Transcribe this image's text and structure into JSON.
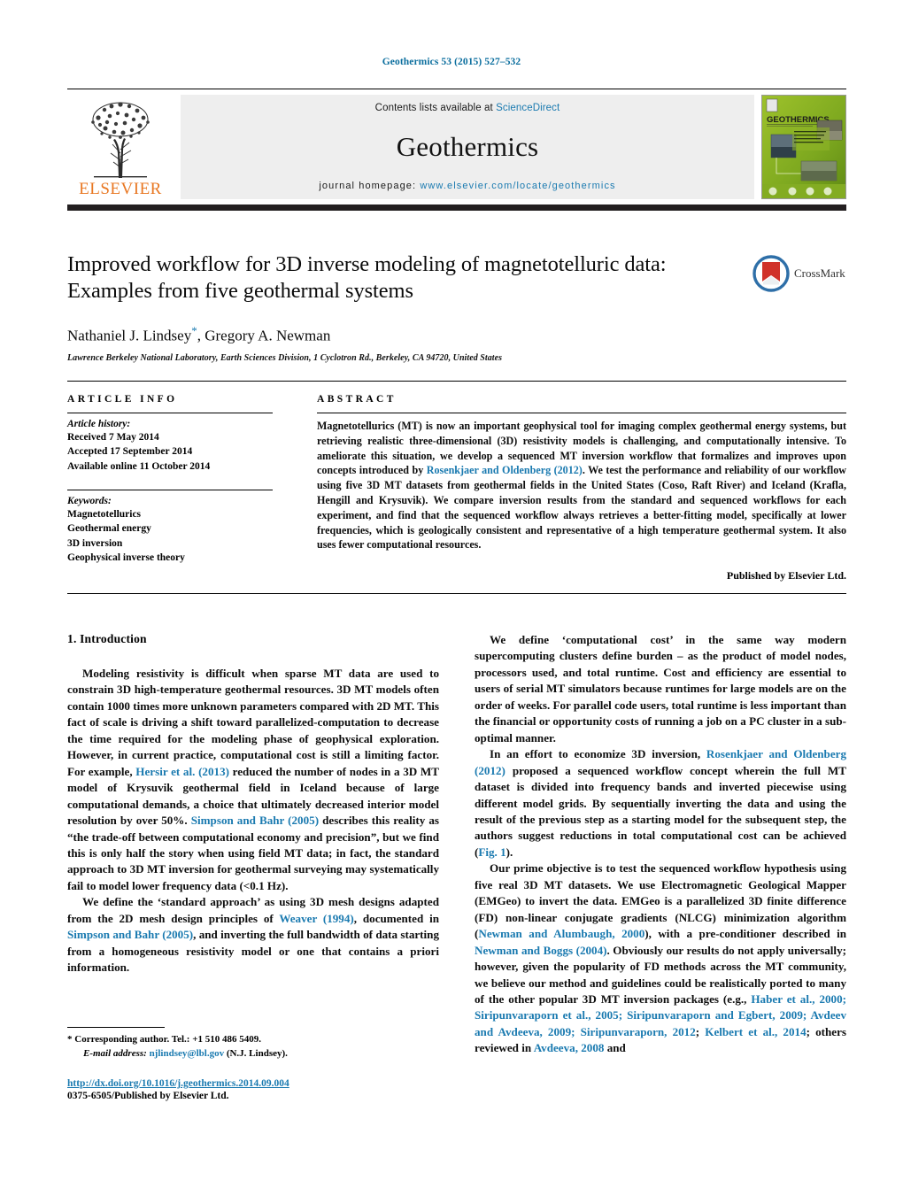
{
  "running_head": "Geothermics 53 (2015) 527–532",
  "masthead": {
    "contents_prefix": "Contents lists available at ",
    "contents_link": "ScienceDirect",
    "journal_title": "Geothermics",
    "homepage_prefix": "journal homepage: ",
    "homepage_url": "www.elsevier.com/locate/geothermics",
    "publisher_logo_text": "ELSEVIER",
    "cover_title": "GEOTHERMICS"
  },
  "title_block": {
    "title": "Improved workflow for 3D inverse modeling of magnetotelluric data: Examples from five geothermal systems",
    "crossmark_label": "CrossMark",
    "authors": "Nathaniel J. Lindsey",
    "authors_tail": ", Gregory A. Newman",
    "corresponding_marker": "*",
    "affiliation": "Lawrence Berkeley National Laboratory, Earth Sciences Division, 1 Cyclotron Rd., Berkeley, CA 94720, United States"
  },
  "article_info": {
    "heading": "ARTICLE INFO",
    "history_label": "Article history:",
    "history": [
      "Received 7 May 2014",
      "Accepted 17 September 2014",
      "Available online 11 October 2014"
    ],
    "keywords_label": "Keywords:",
    "keywords": [
      "Magnetotellurics",
      "Geothermal energy",
      "3D inversion",
      "Geophysical inverse theory"
    ]
  },
  "abstract": {
    "heading": "ABSTRACT",
    "part1": "Magnetotellurics (MT) is now an important geophysical tool for imaging complex geothermal energy systems, but retrieving realistic three-dimensional (3D) resistivity models is challenging, and computationally intensive. To ameliorate this situation, we develop a sequenced MT inversion workflow that formalizes and improves upon concepts introduced by ",
    "ref1": "Rosenkjaer and Oldenberg (2012)",
    "part2": ". We test the performance and reliability of our workflow using five 3D MT datasets from geothermal fields in the United States (Coso, Raft River) and Iceland (Krafla, Hengill and Krysuvik). We compare inversion results from the standard and sequenced workflows for each experiment, and find that the sequenced workflow always retrieves a better-fitting model, specifically at lower frequencies, which is geologically consistent and representative of a high temperature geothermal system. It also uses fewer computational resources.",
    "copyright": "Published by Elsevier Ltd."
  },
  "body": {
    "section_number_title": "1. Introduction",
    "left_paragraphs": [
      {
        "runs": [
          {
            "t": "Modeling resistivity is difficult when sparse MT data are used to constrain 3D high-temperature geothermal resources. 3D MT models often contain 1000 times more unknown parameters compared with 2D MT. This fact of scale is driving a shift toward parallelized-computation to decrease the time required for the modeling phase of geophysical exploration. However, in current practice, computational cost is still a limiting factor. For example, ",
            "ref": false
          },
          {
            "t": "Hersir et al. (2013)",
            "ref": true
          },
          {
            "t": " reduced the number of nodes in a 3D MT model of Krysuvik geothermal field in Iceland because of large computational demands, a choice that ultimately decreased interior model resolution by over 50%. ",
            "ref": false
          },
          {
            "t": "Simpson and Bahr (2005)",
            "ref": true
          },
          {
            "t": " describes this reality as “the trade-off between computational economy and precision”, but we find this is only half the story when using field MT data; in fact, the standard approach to 3D MT inversion for geothermal surveying may systematically fail to model lower frequency data (<0.1 Hz).",
            "ref": false
          }
        ]
      },
      {
        "runs": [
          {
            "t": "We define the ‘standard approach’ as using 3D mesh designs adapted from the 2D mesh design principles of ",
            "ref": false
          },
          {
            "t": "Weaver (1994)",
            "ref": true
          },
          {
            "t": ", documented in ",
            "ref": false
          },
          {
            "t": "Simpson and Bahr (2005)",
            "ref": true
          },
          {
            "t": ", and inverting the full bandwidth of data starting from a homogeneous resistivity model or one that contains a priori information.",
            "ref": false
          }
        ]
      }
    ],
    "right_paragraphs": [
      {
        "runs": [
          {
            "t": "We define ‘computational cost’ in the same way modern supercomputing clusters define burden – as the product of model nodes, processors used, and total runtime. Cost and efficiency are essential to users of serial MT simulators because runtimes for large models are on the order of weeks. For parallel code users, total runtime is less important than the financial or opportunity costs of running a job on a PC cluster in a sub-optimal manner.",
            "ref": false
          }
        ]
      },
      {
        "runs": [
          {
            "t": "In an effort to economize 3D inversion, ",
            "ref": false
          },
          {
            "t": "Rosenkjaer and Oldenberg (2012)",
            "ref": true
          },
          {
            "t": " proposed a sequenced workflow concept wherein the full MT dataset is divided into frequency bands and inverted piecewise using different model grids. By sequentially inverting the data and using the result of the previous step as a starting model for the subsequent step, the authors suggest reductions in total computational cost can be achieved (",
            "ref": false
          },
          {
            "t": "Fig. 1",
            "ref": true
          },
          {
            "t": ").",
            "ref": false
          }
        ]
      },
      {
        "runs": [
          {
            "t": "Our prime objective is to test the sequenced workflow hypothesis using five real 3D MT datasets. We use Electromagnetic Geological Mapper (EMGeo) to invert the data. EMGeo is a parallelized 3D finite difference (FD) non-linear conjugate gradients (NLCG) minimization algorithm (",
            "ref": false
          },
          {
            "t": "Newman and Alumbaugh, 2000",
            "ref": true
          },
          {
            "t": "), with a pre-conditioner described in ",
            "ref": false
          },
          {
            "t": "Newman and Boggs (2004)",
            "ref": true
          },
          {
            "t": ". Obviously our results do not apply universally; however, given the popularity of FD methods across the MT community, we believe our method and guidelines could be realistically ported to many of the other popular 3D MT inversion packages (e.g., ",
            "ref": false
          },
          {
            "t": "Haber et al., 2000; Siripunvaraporn et al., 2005; Siripunvaraporn and Egbert, 2009; Avdeev and Avdeeva, 2009; Siripunvaraporn, 2012",
            "ref": true
          },
          {
            "t": "; ",
            "ref": false
          },
          {
            "t": "Kelbert et al., 2014",
            "ref": true
          },
          {
            "t": "; others reviewed in ",
            "ref": false
          },
          {
            "t": "Avdeeva, 2008",
            "ref": true
          },
          {
            "t": " and",
            "ref": false
          }
        ]
      }
    ]
  },
  "footnote": {
    "marker": "*",
    "corresponding": "Corresponding author. Tel.: +1 510 486 5409.",
    "email_label": "E-mail address:",
    "email": "njlindsey@lbl.gov",
    "email_owner": "(N.J. Lindsey)."
  },
  "doi": {
    "url": "http://dx.doi.org/10.1016/j.geothermics.2014.09.004",
    "issn_line": "0375-6505/Published by Elsevier Ltd."
  },
  "colors": {
    "link": "#1a7ab0",
    "elsevier_orange": "#E87722",
    "rule_black": "#231f20"
  }
}
